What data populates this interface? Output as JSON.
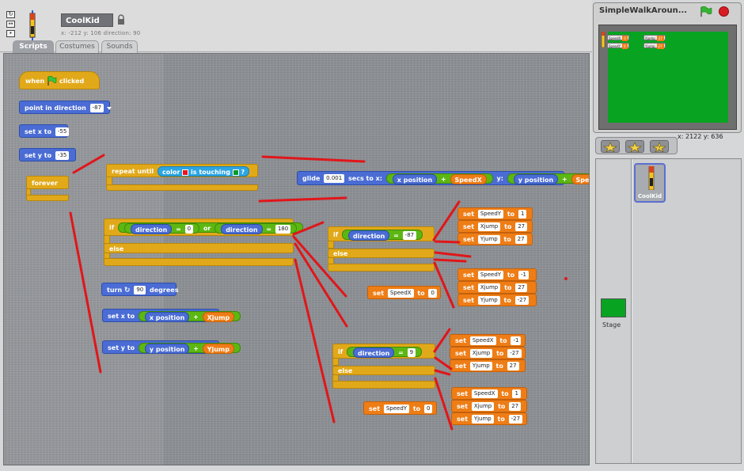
{
  "sprite": {
    "name": "CoolKid",
    "info": "x: -212  y: 106  direction: 90"
  },
  "tabs": {
    "scripts": "Scripts",
    "costumes": "Costumes",
    "sounds": "Sounds"
  },
  "colors": {
    "motion": "#4a6cd4",
    "control": "#e1a91a",
    "variables": "#ee7d16",
    "sensing": "#2ca5e2",
    "operators": "#5cb712",
    "annotation": "#e0161a",
    "stage": "#08a321"
  },
  "blocks": {
    "hat": {
      "prefix": "when",
      "suffix": "clicked"
    },
    "point_dir": {
      "label": "point in direction",
      "value": "-87"
    },
    "set_x": {
      "label": "set x to",
      "value": "-55"
    },
    "set_y": {
      "label": "set y to",
      "value": "-35"
    },
    "forever": "forever",
    "repeat_until": {
      "label": "repeat until",
      "color_label": "color",
      "touching": "is touching",
      "q": "?"
    },
    "glide": {
      "label": "glide",
      "secs_value": "0.001",
      "secs": "secs to x:",
      "xpos": "x position",
      "plus": "+",
      "speedx": "SpeedX",
      "y": "y:",
      "ypos": "y position",
      "speedy": "SpeedY"
    },
    "if1": {
      "if": "if",
      "dir1": "direction",
      "eq1": "=",
      "v1": "0",
      "or": "or",
      "dir2": "direction",
      "eq2": "=",
      "v2": "180",
      "else": "else"
    },
    "turn": {
      "label": "turn",
      "value": "90",
      "degrees": "degrees"
    },
    "set_x_jump": {
      "label": "set x to",
      "xpos": "x position",
      "plus": "+",
      "var": "Xjump"
    },
    "set_y_jump": {
      "label": "set y to",
      "ypos": "y position",
      "plus": "+",
      "var": "Yjump"
    },
    "if2": {
      "if": "if",
      "dir": "direction",
      "eq": "=",
      "v": "-87",
      "else": "else"
    },
    "set_speedx_0": {
      "set": "set",
      "var": "SpeedX",
      "to": "to",
      "value": "0"
    },
    "group_a": [
      {
        "set": "set",
        "var": "SpeedY",
        "to": "to",
        "value": "1"
      },
      {
        "set": "set",
        "var": "Xjump",
        "to": "to",
        "value": "27"
      },
      {
        "set": "set",
        "var": "Yjump",
        "to": "to",
        "value": "27"
      }
    ],
    "group_b": [
      {
        "set": "set",
        "var": "SpeedY",
        "to": "to",
        "value": "-1"
      },
      {
        "set": "set",
        "var": "Xjump",
        "to": "to",
        "value": "27"
      },
      {
        "set": "set",
        "var": "Yjump",
        "to": "to",
        "value": "-27"
      }
    ],
    "if3": {
      "if": "if",
      "dir": "direction",
      "eq": "=",
      "v": "9",
      "else": "else"
    },
    "set_speedy_0": {
      "set": "set",
      "var": "SpeedY",
      "to": "to",
      "value": "0"
    },
    "group_c": [
      {
        "set": "set",
        "var": "SpeedX",
        "to": "to",
        "value": "-1"
      },
      {
        "set": "set",
        "var": "Xjump",
        "to": "to",
        "value": "-27"
      },
      {
        "set": "set",
        "var": "Yjump",
        "to": "to",
        "value": "27"
      }
    ],
    "group_d": [
      {
        "set": "set",
        "var": "SpeedX",
        "to": "to",
        "value": "1"
      },
      {
        "set": "set",
        "var": "Xjump",
        "to": "to",
        "value": "27"
      },
      {
        "set": "set",
        "var": "Yjump",
        "to": "to",
        "value": "-27"
      }
    ]
  },
  "stage": {
    "title": "SimpleWalkAroun...",
    "mouse_x_label": "x:",
    "mouse_x": "2122",
    "mouse_y_label": "y:",
    "mouse_y": "636",
    "monitors": [
      {
        "label": "SpeedX",
        "value": "0"
      },
      {
        "label": "SpeedY",
        "value": "0"
      },
      {
        "label": "Xjump",
        "value": "27"
      },
      {
        "label": "Yjump",
        "value": "27"
      }
    ]
  },
  "sprites_panel": {
    "stage_label": "Stage",
    "sprite_label": "CoolKid"
  }
}
